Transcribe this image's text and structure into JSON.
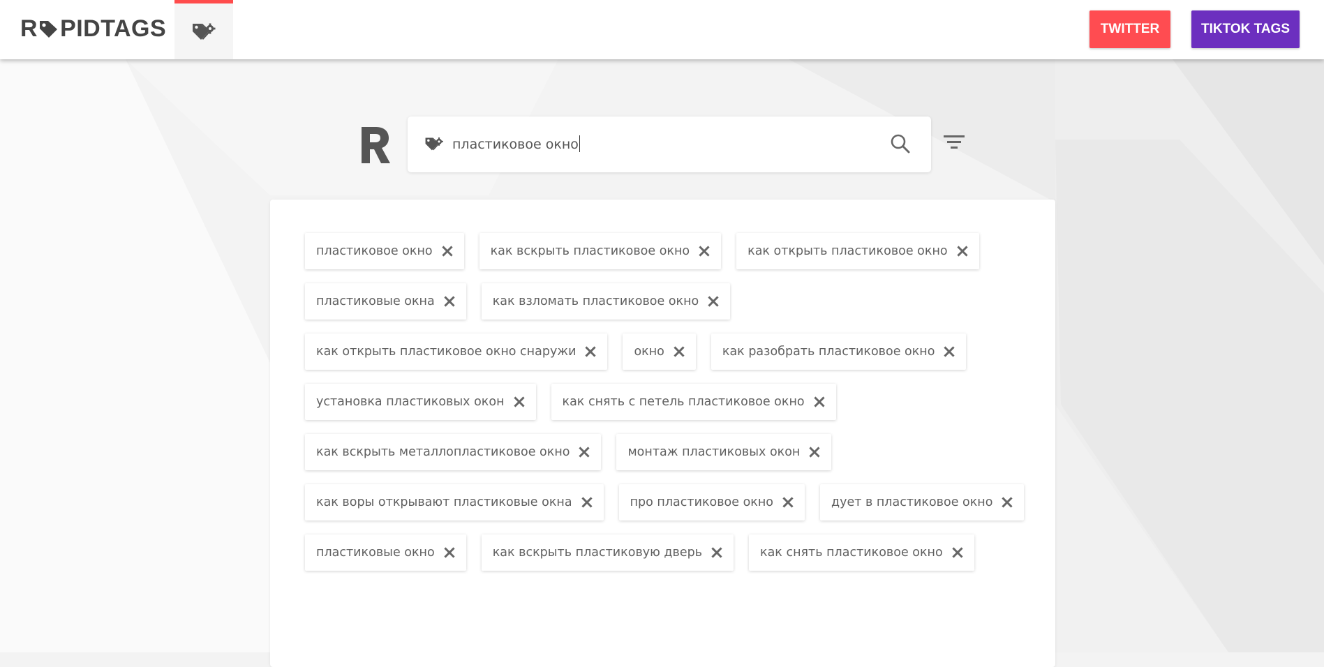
{
  "header": {
    "logo_text": "RAPIDTAGS",
    "logo_before": "R",
    "logo_after": "PIDTAGS",
    "twitter_label": "TWITTER",
    "tiktok_label": "TIKTOK TAGS"
  },
  "search": {
    "value": "пластиковое окно"
  },
  "tags": [
    "пластиковое окно",
    "как вскрыть пластиковое окно",
    "как открыть пластиковое окно",
    "пластиковые окна",
    "как взломать пластиковое окно",
    "как открыть пластиковое окно снаружи",
    "окно",
    "как разобрать пластиковое окно",
    "установка пластиковых окон",
    "как снять с петель пластиковое окно",
    "как вскрыть металлопластиковое окно",
    "монтаж пластиковых окон",
    "как воры открывают пластиковые окна",
    "про пластиковое окно",
    "дует в пластиковое окно",
    "пластиковые окно",
    "как вскрыть пластиковую дверь",
    "как снять пластиковое окно"
  ],
  "colors": {
    "accent_red": "#ff4c51",
    "accent_purple": "#6c2fbf",
    "text": "#616161",
    "logo": "#444444"
  },
  "icons": {
    "nav": "tag-gear-icon",
    "search": "search-icon",
    "filter": "filter-icon",
    "remove": "close-icon"
  }
}
